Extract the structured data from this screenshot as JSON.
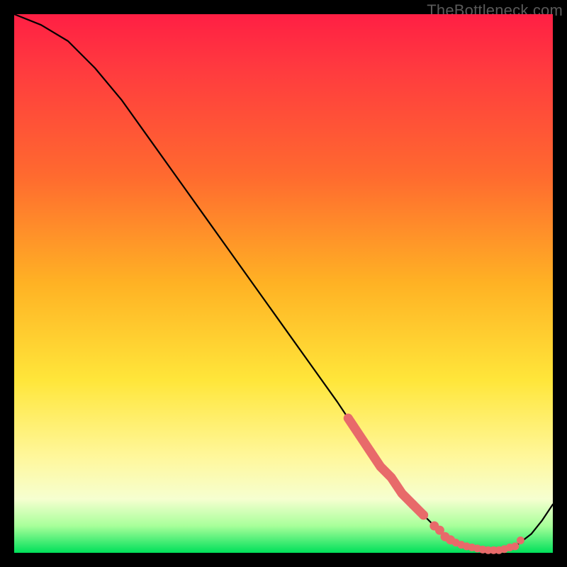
{
  "watermark": "TheBottleneck.com",
  "colors": {
    "marker": "#e86a6a",
    "curve": "#000000"
  },
  "chart_data": {
    "type": "line",
    "title": "",
    "xlabel": "",
    "ylabel": "",
    "xlim": [
      0,
      100
    ],
    "ylim": [
      0,
      100
    ],
    "grid": false,
    "series": [
      {
        "name": "curve",
        "x": [
          0,
          5,
          10,
          15,
          20,
          25,
          30,
          35,
          40,
          45,
          50,
          55,
          60,
          62,
          65,
          70,
          75,
          78,
          80,
          83,
          86,
          88,
          90,
          93,
          96,
          98,
          100
        ],
        "y": [
          100,
          98,
          95,
          90,
          84,
          77,
          70,
          63,
          56,
          49,
          42,
          35,
          28,
          25,
          20,
          14,
          8,
          5,
          3,
          1.5,
          0.8,
          0.5,
          0.5,
          1.2,
          3.5,
          6,
          9
        ]
      }
    ],
    "markers": {
      "name": "highlight-region",
      "comment": "salmon dotted segment near the trough",
      "x": [
        62,
        64,
        66,
        68,
        70,
        72,
        74,
        76,
        78,
        79,
        80,
        81,
        82,
        83,
        84,
        85,
        86,
        87,
        88,
        89,
        90,
        91,
        92,
        93,
        94
      ],
      "y": [
        25,
        22,
        19,
        16,
        14,
        11,
        9,
        7,
        5,
        4.2,
        3,
        2.4,
        1.9,
        1.5,
        1.2,
        1.0,
        0.8,
        0.6,
        0.5,
        0.5,
        0.5,
        0.7,
        1.0,
        1.2,
        2.3
      ]
    }
  }
}
